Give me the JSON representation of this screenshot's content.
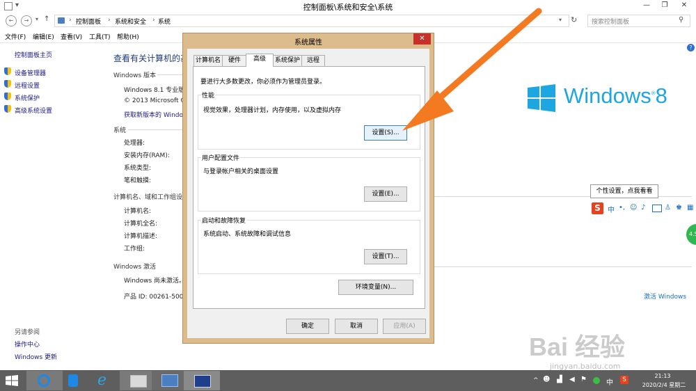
{
  "window": {
    "title": "控制面板\\系统和安全\\系统",
    "minimize": "—",
    "maximize": "❐",
    "close": "✕"
  },
  "address": {
    "breadcrumb": [
      "控制面板",
      "系统和安全",
      "系统"
    ],
    "search_placeholder": "搜索控制面板"
  },
  "menu": [
    "文件(F)",
    "编辑(E)",
    "查看(V)",
    "工具(T)",
    "帮助(H)"
  ],
  "sidebar": {
    "home": "控制面板主页",
    "links": [
      "设备管理器",
      "远程设置",
      "系统保护",
      "高级系统设置"
    ],
    "see_also_title": "另请参阅",
    "see_also": [
      "操作中心",
      "Windows 更新"
    ]
  },
  "main": {
    "heading": "查看有关计算机的基",
    "edition_header": "Windows 版本",
    "edition": "Windows 8.1 专业版",
    "copyright": "© 2013 Microsoft C",
    "get_more": "获取新版本的 Windo",
    "system_header": "系统",
    "system_rows": [
      "处理器:",
      "安装内存(RAM):",
      "系统类型:",
      "笔和触摸:"
    ],
    "network_header": "计算机名、域和工作组设",
    "network_rows": [
      "计算机名:",
      "计算机全名:",
      "计算机描述:",
      "工作组:"
    ],
    "activation_header": "Windows 激活",
    "activation_status": "Windows 尚未激活。",
    "product_id": "产品 ID: 00261-5000",
    "activate_link": "激活 Windows",
    "logo_text": "Windows",
    "logo_num": "8"
  },
  "dialog": {
    "title": "系统属性",
    "tabs": [
      "计算机名",
      "硬件",
      "高级",
      "系统保护",
      "远程"
    ],
    "admin_note": "要进行大多数更改，你必须作为管理员登录。",
    "performance": {
      "title": "性能",
      "desc": "视觉效果，处理器计划，内存使用，以及虚拟内存",
      "button": "设置(S)..."
    },
    "profiles": {
      "title": "用户配置文件",
      "desc": "与登录帐户相关的桌面设置",
      "button": "设置(E)..."
    },
    "startup": {
      "title": "启动和故障恢复",
      "desc": "系统启动、系统故障和调试信息",
      "button": "设置(T)..."
    },
    "env_button": "环境变量(N)...",
    "ok": "确定",
    "cancel": "取消",
    "apply": "应用(A)"
  },
  "ime": {
    "tooltip": "个性设置，点我看看",
    "lang": "中",
    "badge": "4.5"
  },
  "taskbar": {
    "time": "21:13",
    "date": "2020/2/4 星期二",
    "tray_lang": "中"
  },
  "watermark": {
    "text": "Bai 经验",
    "url": "jingyan.baidu.com"
  },
  "colors": {
    "dialog_frame": "#dcbc8d",
    "close_red": "#c7312a",
    "link_blue": "#1a1a8a",
    "logo_blue": "#1ea6e0",
    "arrow_orange": "#f37a20",
    "taskbar": "#5e5e5e"
  }
}
